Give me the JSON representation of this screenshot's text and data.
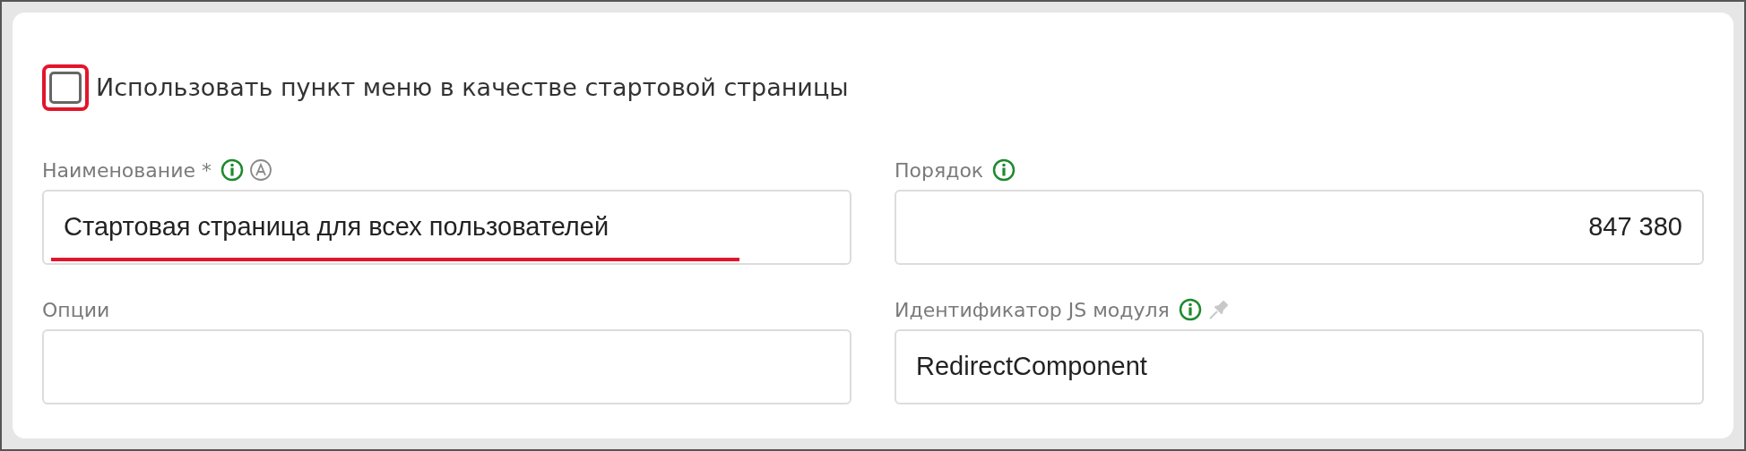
{
  "start_page_checkbox": {
    "label": "Использовать пункт меню в качестве стартовой страницы",
    "checked": false,
    "highlighted": true
  },
  "fields": [
    {
      "label": "Наименование *",
      "info": true,
      "auto": true,
      "value": "Стартовая страница для всех пользователей",
      "underlined": true
    },
    {
      "label": "Порядок",
      "info": true,
      "value": "847 380",
      "align_right": true
    },
    {
      "label": "Опции"
    },
    {
      "label": "Идентификатор JS модуля",
      "info": true,
      "pin": true,
      "value": "RedirectComponent"
    }
  ]
}
